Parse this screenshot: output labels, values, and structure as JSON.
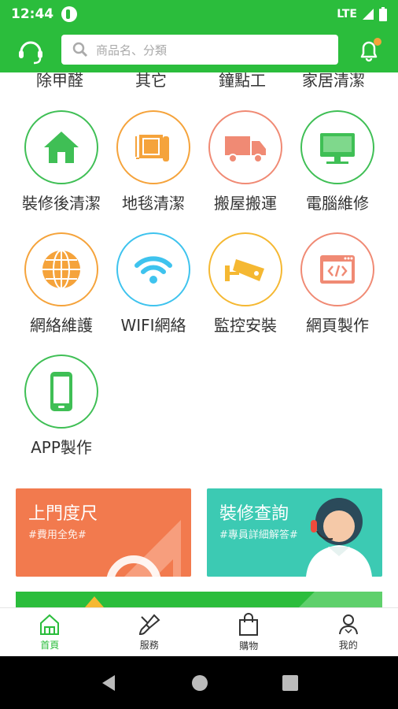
{
  "status": {
    "time": "12:44",
    "network": "LTE"
  },
  "search": {
    "placeholder": "商品名、分類"
  },
  "top_row": [
    "除甲醛",
    "其它",
    "鐘點工",
    "家居清潔"
  ],
  "categories": [
    {
      "label": "裝修後清潔",
      "icon": "house-icon",
      "color": "#3fbf55"
    },
    {
      "label": "地毯清潔",
      "icon": "carpet-icon",
      "color": "#f5a33b"
    },
    {
      "label": "搬屋搬運",
      "icon": "truck-icon",
      "color": "#f08a74"
    },
    {
      "label": "電腦維修",
      "icon": "monitor-icon",
      "color": "#3fbf55"
    },
    {
      "label": "網絡維護",
      "icon": "globe-icon",
      "color": "#f5a33b"
    },
    {
      "label": "WIFI網絡",
      "icon": "wifi-icon",
      "color": "#3ec3ee"
    },
    {
      "label": "監控安裝",
      "icon": "camera-icon",
      "color": "#f5b832"
    },
    {
      "label": "網頁製作",
      "icon": "code-window-icon",
      "color": "#f08a74"
    },
    {
      "label": "APP製作",
      "icon": "phone-icon",
      "color": "#3fbf55"
    }
  ],
  "banners": {
    "measure": {
      "title": "上門度尺",
      "sub": "#費用全免#",
      "color": "#f27a4e"
    },
    "consult": {
      "title": "裝修查詢",
      "sub": "#專員詳細解答#",
      "color": "#3ccab3"
    }
  },
  "nav": {
    "home": "首頁",
    "service": "服務",
    "shop": "購物",
    "me": "我的"
  },
  "colors": {
    "brand": "#2bbd3c"
  }
}
